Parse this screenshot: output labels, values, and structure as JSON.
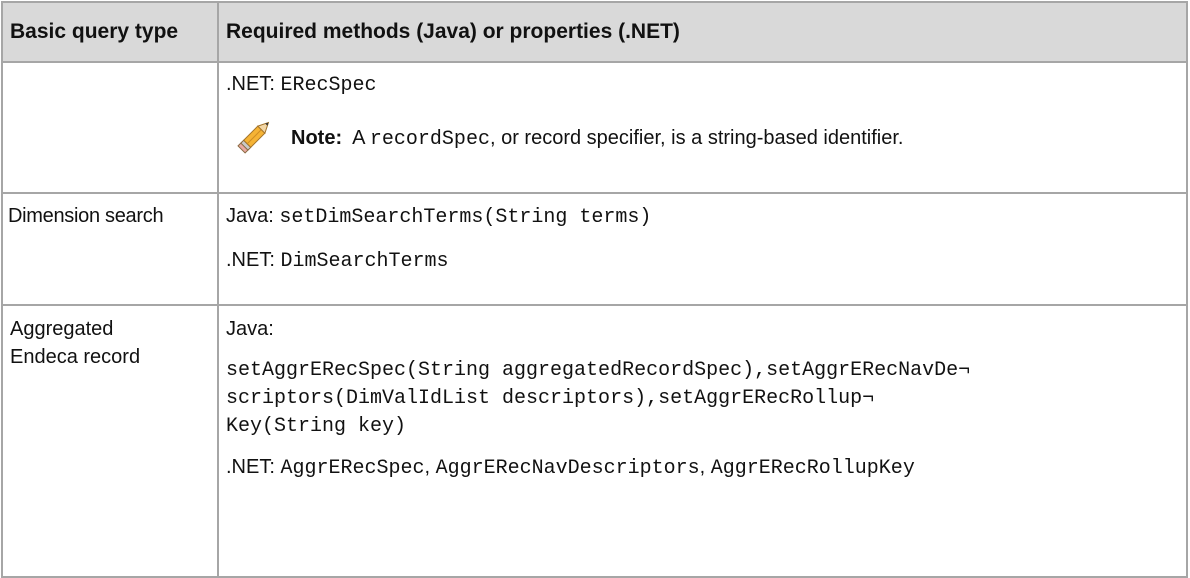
{
  "table": {
    "headers": [
      "Basic query type",
      "Required methods (Java) or properties (.NET)"
    ],
    "row1": {
      "net_label": ".NET: ",
      "net_code": "ERecSpec",
      "note": {
        "label": "Note:",
        "text_before": "A ",
        "code": "recordSpec",
        "text_after": ", or record specifier, is a string-based identifier."
      }
    },
    "row2": {
      "type": "Dimension search",
      "java_label": "Java: ",
      "java_code": "setDimSearchTerms(String terms)",
      "net_label": ".NET: ",
      "net_code": "DimSearchTerms"
    },
    "row3": {
      "type_line1": "Aggregated",
      "type_line2": "Endeca record",
      "java_label": "Java:",
      "code_line1": "setAggrERecSpec(String aggregatedRecordSpec),setAggrERecNavDe¬",
      "code_line2": "scriptors(DimValIdList descriptors),setAggrERecRollup¬",
      "code_line3": "Key(String key)",
      "net_label": ".NET: ",
      "net_code_1": "AggrERecSpec",
      "sep": ", ",
      "net_code_2": "AggrERecNavDescriptors",
      "net_code_3": "AggrERecRollupKey"
    }
  }
}
